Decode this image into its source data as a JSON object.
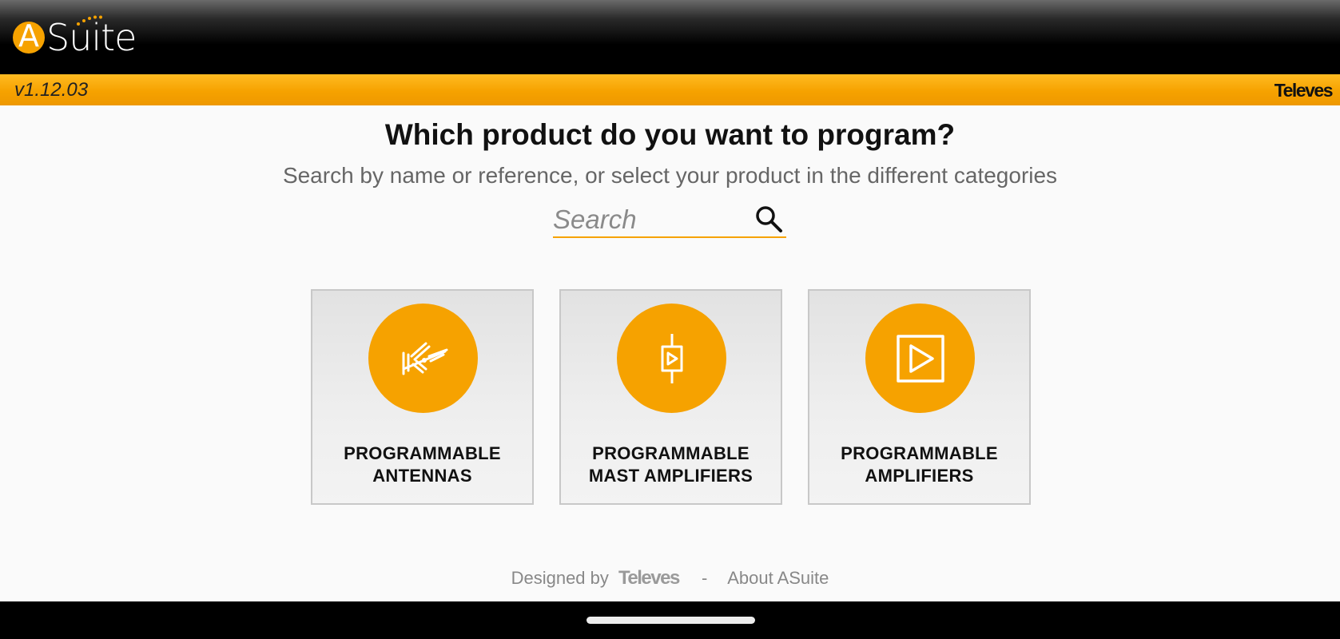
{
  "app": {
    "logo_letter": "A",
    "logo_text": "Suite",
    "version": "v1.12.03",
    "brand": "Televes"
  },
  "main": {
    "title": "Which product do you want to program?",
    "subtitle": "Search by name or reference, or select your product in the different categories"
  },
  "search": {
    "placeholder": "Search",
    "icon": "search-icon"
  },
  "categories": [
    {
      "icon": "antenna-icon",
      "line1": "PROGRAMMABLE",
      "line2": "ANTENNAS"
    },
    {
      "icon": "mast-amplifier-icon",
      "line1": "PROGRAMMABLE",
      "line2": "MAST AMPLIFIERS"
    },
    {
      "icon": "amplifier-icon",
      "line1": "PROGRAMMABLE",
      "line2": "AMPLIFIERS"
    }
  ],
  "footer": {
    "designed_by": "Designed by",
    "brand": "Televes",
    "separator": "-",
    "about": "About ASuite"
  },
  "colors": {
    "accent": "#f6a200",
    "header": "#000000",
    "background": "#fafafa"
  }
}
